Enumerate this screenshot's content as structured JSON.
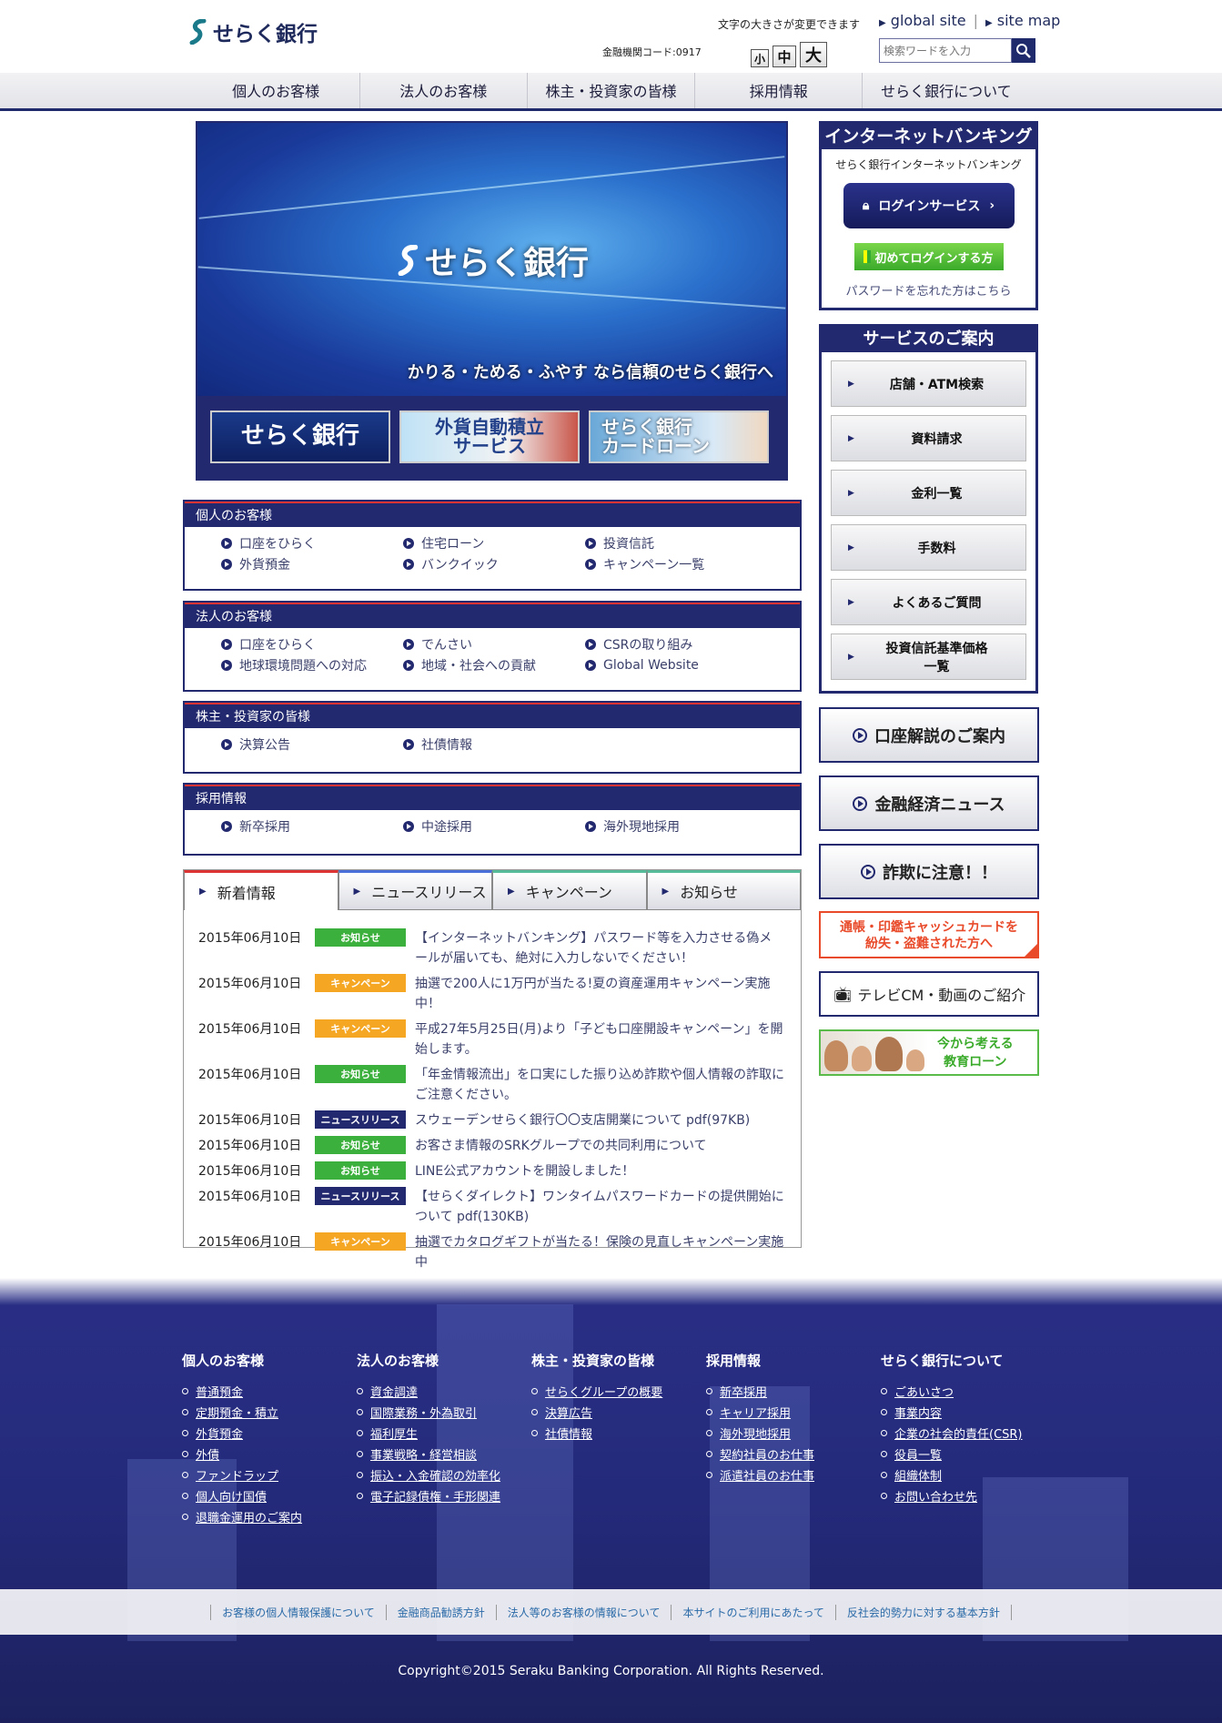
{
  "header": {
    "logo_text": "せらく銀行",
    "font_size_label": "文字の大きさが変更できます",
    "bank_code": "金融機関コード:0917",
    "size_small": "小",
    "size_medium": "中",
    "size_large": "大",
    "global_site": "global site",
    "site_map": "site map",
    "search_placeholder": "検索ワードを入力"
  },
  "nav": [
    "個人のお客様",
    "法人のお客様",
    "株主・投資家の皆様",
    "採用情報",
    "せらく銀行について"
  ],
  "hero": {
    "logo_text": "せらく銀行",
    "tagline": "かりる・ためる・ふやす なら信頼のせらく銀行へ",
    "banners": [
      "せらく銀行",
      "外貨自動積立\nサービス",
      "せらく銀行\nカードローン"
    ]
  },
  "sections": [
    {
      "title": "個人のお客様",
      "links": [
        "口座をひらく",
        "住宅ローン",
        "投資信託",
        "外貨預金",
        "バンクイック",
        "キャンペーン一覧"
      ]
    },
    {
      "title": "法人のお客様",
      "links": [
        "口座をひらく",
        "でんさい",
        "CSRの取り組み",
        "地球環境問題への対応",
        "地域・社会への貢献",
        "Global Website"
      ]
    },
    {
      "title": "株主・投資家の皆様",
      "links": [
        "決算公告",
        "社債情報"
      ]
    },
    {
      "title": "採用情報",
      "links": [
        "新卒採用",
        "中途採用",
        "海外現地採用"
      ]
    }
  ],
  "tabs": [
    "新着情報",
    "ニュースリリース",
    "キャンペーン",
    "お知らせ"
  ],
  "news": [
    {
      "date": "2015年06月10日",
      "badge": "お知らせ",
      "color": "#3cb03c",
      "title": "【インターネットバンキング】パスワード等を入力させる偽メールが届いても、絶対に入力しないでください！"
    },
    {
      "date": "2015年06月10日",
      "badge": "キャンペーン",
      "color": "#f5a623",
      "title": "抽選で200人に1万円が当たる!夏の資産運用キャンペーン実施中！"
    },
    {
      "date": "2015年06月10日",
      "badge": "キャンペーン",
      "color": "#f5a623",
      "title": "平成27年5月25日(月)より「子ども口座開設キャンペーン」を開始します。"
    },
    {
      "date": "2015年06月10日",
      "badge": "お知らせ",
      "color": "#3cb03c",
      "title": "「年金情報流出」を口実にした振り込め詐欺や個人情報の詐取にご注意ください。"
    },
    {
      "date": "2015年06月10日",
      "badge": "ニュースリリース",
      "color": "#23296e",
      "title": "スウェーデンせらく銀行〇〇支店開業について pdf(97KB)"
    },
    {
      "date": "2015年06月10日",
      "badge": "お知らせ",
      "color": "#3cb03c",
      "title": "お客さま情報のSRKグループでの共同利用について"
    },
    {
      "date": "2015年06月10日",
      "badge": "お知らせ",
      "color": "#3cb03c",
      "title": "LINE公式アカウントを開設しました！"
    },
    {
      "date": "2015年06月10日",
      "badge": "ニュースリリース",
      "color": "#23296e",
      "title": "【せらくダイレクト】ワンタイムパスワードカードの提供開始について pdf(130KB)"
    },
    {
      "date": "2015年06月10日",
      "badge": "キャンペーン",
      "color": "#f5a623",
      "title": "抽選でカタログギフトが当たる！保険の見直しキャンペーン実施中"
    }
  ],
  "internet_banking": {
    "title": "インターネットバンキング",
    "subtitle": "せらく銀行インターネットバンキング",
    "login": "ログインサービス",
    "first_login": "初めてログインする方",
    "forgot": "パスワードを忘れた方はこちら"
  },
  "services": {
    "title": "サービスのご案内",
    "items": [
      "店舗・ATM検索",
      "資料請求",
      "金利一覧",
      "手数料",
      "よくあるご質問",
      "投資信託基準価格一覧"
    ]
  },
  "side_buttons": [
    "口座解説のご案内",
    "金融経済ニュース",
    "詐欺に注意！！"
  ],
  "lost_banner": [
    "通帳・印鑑キャッシュカードを",
    "紛失・盗難された方へ"
  ],
  "tvcm": "テレビCM・動画のご紹介",
  "edu_loan": [
    "今から考える",
    "教育ローン"
  ],
  "footer": {
    "columns": [
      {
        "title": "個人のお客様",
        "links": [
          "普通預金",
          "定期預金・積立",
          "外貨預金",
          "外債",
          "ファンドラップ",
          "個人向け国債",
          "退職金運用のご案内"
        ]
      },
      {
        "title": "法人のお客様",
        "links": [
          "資金調達",
          "国際業務・外為取引",
          "福利厚生",
          "事業戦略・経営相談",
          "振込・入金確認の効率化",
          "電子記録債権・手形関連"
        ]
      },
      {
        "title": "株主・投資家の皆様",
        "links": [
          "せらくグループの概要",
          "決算広告",
          "社債情報"
        ]
      },
      {
        "title": "採用情報",
        "links": [
          "新卒採用",
          "キャリア採用",
          "海外現地採用",
          "契約社員のお仕事",
          "派遣社員のお仕事"
        ]
      },
      {
        "title": "せらく銀行について",
        "links": [
          "ごあいさつ",
          "事業内容",
          "企業の社会的責任(CSR)",
          "役員一覧",
          "組織体制",
          "お問い合わせ先"
        ]
      }
    ],
    "bar_links": [
      "お客様の個人情報保護について",
      "金融商品勧誘方針",
      "法人等のお客様の情報について",
      "本サイトのご利用にあたって",
      "反社会的勢力に対する基本方針"
    ],
    "copyright": "Copyright©2015 Seraku Banking Corporation. All Rights Reserved."
  },
  "colors": {
    "navy": "#23296e",
    "green": "#3cb03c",
    "orange": "#f5a623",
    "red": "#e84a2a"
  }
}
